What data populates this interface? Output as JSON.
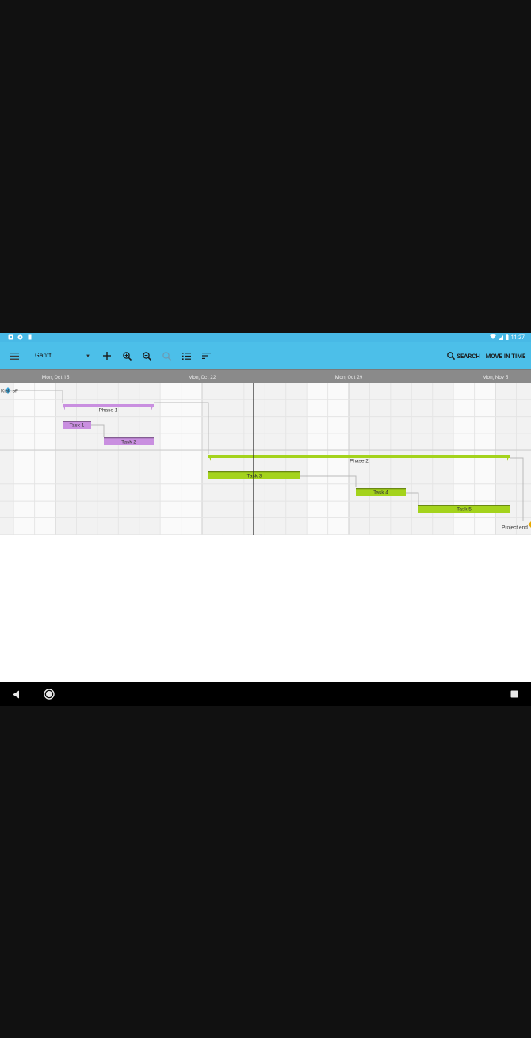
{
  "status_bar": {
    "time": "11:27",
    "left_icons": [
      "notification-icon",
      "settings-icon",
      "sd-card-icon"
    ],
    "right_icons": [
      "wifi-icon",
      "signal-icon",
      "battery-icon"
    ]
  },
  "toolbar": {
    "view_selected": "Gantt",
    "icons": [
      "menu-icon",
      "add-icon",
      "zoom-in-icon",
      "zoom-out-icon",
      "zoom-reset-icon",
      "list-icon",
      "sort-icon"
    ],
    "search_label": "SEARCH",
    "move_label": "MOVE IN TIME"
  },
  "timeline": {
    "week_labels": [
      "Mon, Oct 15",
      "Mon, Oct 22",
      "Mon, Oct 29",
      "Mon, Nov 5"
    ]
  },
  "gantt": {
    "milestones": [
      {
        "name": "Kick-off"
      },
      {
        "name": "Project end"
      }
    ],
    "summary_tasks": [
      {
        "name": "Phase 1",
        "color": "#c98fe0"
      },
      {
        "name": "Phase 2",
        "color": "#a4d31c"
      }
    ],
    "tasks": [
      {
        "name": "Task 1",
        "color": "#c98fe0"
      },
      {
        "name": "Task 2",
        "color": "#c98fe0"
      },
      {
        "name": "Task 3",
        "color": "#a4d31c"
      },
      {
        "name": "Task 4",
        "color": "#a4d31c"
      },
      {
        "name": "Task 5",
        "color": "#a4d31c"
      }
    ]
  },
  "colors": {
    "toolbar": "#4cbfe9",
    "status_bar": "#48b9e6",
    "header": "#8a8a8a",
    "phase1": "#c98fe0",
    "phase2": "#a4d31c"
  }
}
